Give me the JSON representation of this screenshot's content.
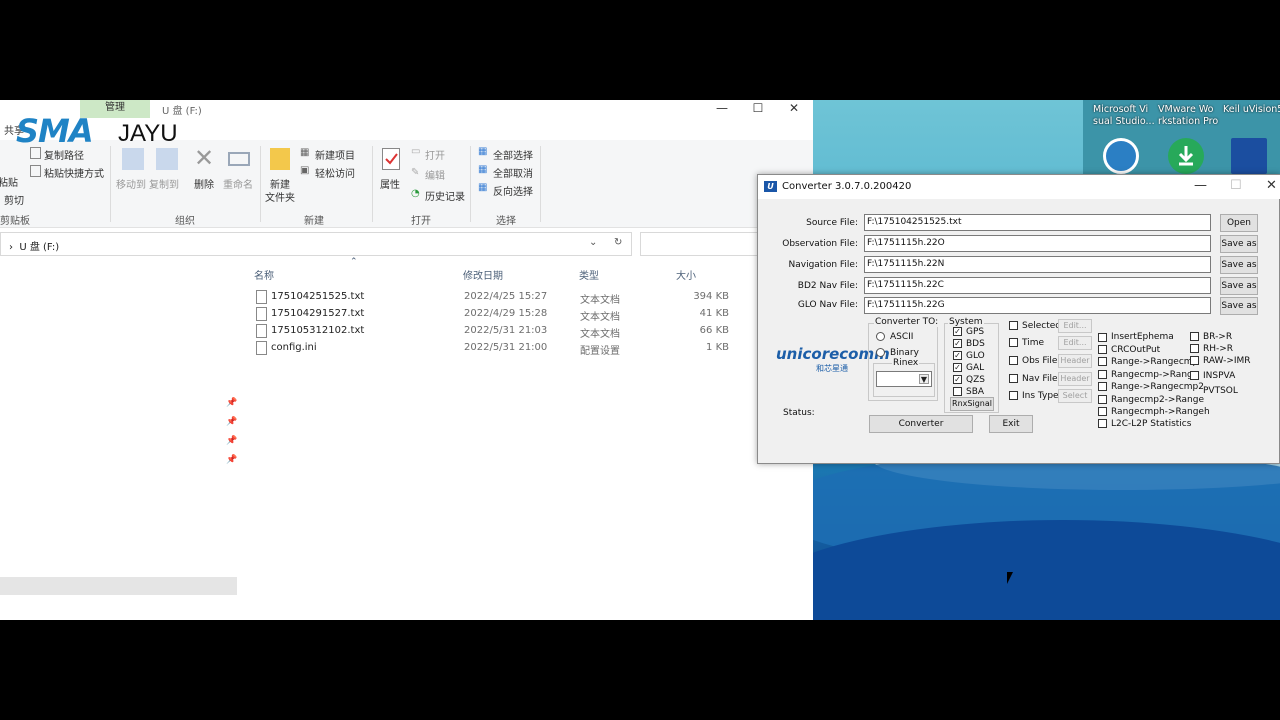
{
  "explorer": {
    "manage_tab": "管理",
    "drive_title": "U 盘 (F:)",
    "share_tab": "共享",
    "logo_sma": "SMA",
    "logo_jayu": "JAYU",
    "ribbon": {
      "paste": "粘贴",
      "copy_path": "复制路径",
      "paste_shortcut": "粘贴快捷方式",
      "cut": "剪切",
      "move_to": "移动到",
      "copy_to": "复制到",
      "delete": "删除",
      "rename": "重命名",
      "new_folder_1": "新建",
      "new_folder_2": "文件夹",
      "new_item": "新建项目",
      "easy_access": "轻松访问",
      "properties": "属性",
      "open": "打开",
      "edit": "编辑",
      "history": "历史记录",
      "select_all": "全部选择",
      "select_none": "全部取消",
      "invert": "反向选择",
      "groups": {
        "clipboard": "剪贴板",
        "organize": "组织",
        "new": "新建",
        "open": "打开",
        "select": "选择"
      }
    },
    "address": "U 盘 (F:)",
    "columns": {
      "name": "名称",
      "date": "修改日期",
      "type": "类型",
      "size": "大小"
    },
    "files": [
      {
        "name": "175104251525.txt",
        "date": "2022/4/25 15:27",
        "type": "文本文档",
        "size": "394 KB"
      },
      {
        "name": "175104291527.txt",
        "date": "2022/4/29 15:28",
        "type": "文本文档",
        "size": "41 KB"
      },
      {
        "name": "175105312102.txt",
        "date": "2022/5/31 21:03",
        "type": "文本文档",
        "size": "66 KB"
      },
      {
        "name": "config.ini",
        "date": "2022/5/31 21:00",
        "type": "配置设置",
        "size": "1 KB"
      }
    ]
  },
  "desktop": {
    "icons": [
      {
        "label": "Microsoft Visual Studio...",
        "icon": "visual-studio-icon"
      },
      {
        "label": "VMware Workstation Pro",
        "icon": "vmware-icon"
      },
      {
        "label": "Keil uVision5",
        "icon": "keil-icon"
      }
    ],
    "icon_labels": [
      "Microsoft Vi sual Studio...",
      "VMware Wo rkstation Pro",
      "Keil uVision5"
    ]
  },
  "converter": {
    "title": "Converter  3.0.7.0.200420",
    "fields": [
      {
        "label": "Source File:",
        "value": "F:\\175104251525.txt",
        "button": "Open"
      },
      {
        "label": "Observation File:",
        "value": "F:\\1751115h.22O",
        "button": "Save as"
      },
      {
        "label": "Navigation File:",
        "value": "F:\\1751115h.22N",
        "button": "Save as"
      },
      {
        "label": "BD2 Nav File:",
        "value": "F:\\1751115h.22C",
        "button": "Save as"
      },
      {
        "label": "GLO Nav File:",
        "value": "F:\\1751115h.22G",
        "button": "Save as"
      }
    ],
    "converter_to": {
      "label": "Converter TO:",
      "options": [
        "ASCII",
        "Binary"
      ],
      "rinex": "Rinex",
      "rinex_value": ""
    },
    "system": {
      "label": "System",
      "items": [
        {
          "name": "GPS",
          "checked": true
        },
        {
          "name": "BDS",
          "checked": true
        },
        {
          "name": "GLO",
          "checked": true
        },
        {
          "name": "GAL",
          "checked": true
        },
        {
          "name": "QZS",
          "checked": true
        },
        {
          "name": "SBA",
          "checked": false
        }
      ],
      "rnx_signal": "RnxSignal"
    },
    "filters": [
      {
        "name": "Selected",
        "btn": "Edit..."
      },
      {
        "name": "Time",
        "btn": "Edit..."
      },
      {
        "name": "Obs File",
        "btn": "Header"
      },
      {
        "name": "Nav File",
        "btn": "Header"
      },
      {
        "name": "Ins Type",
        "btn": "Select"
      }
    ],
    "options_left": [
      "InsertEphema",
      "CRCOutPut",
      "Range->Rangecmp",
      "Rangecmp->Range",
      "Range->Rangecmp2",
      "Rangecmp2->Range",
      "Rangecmph->Rangeh",
      "L2C-L2P Statistics"
    ],
    "options_right": [
      "BR->R",
      "RH->R",
      "RAW->IMR",
      "INSPVA",
      "PVTSOL"
    ],
    "status_label": "Status:",
    "convert_btn": "Converter",
    "exit_btn": "Exit",
    "logo": "unicorecomm",
    "logo_sub": "和芯星通"
  }
}
